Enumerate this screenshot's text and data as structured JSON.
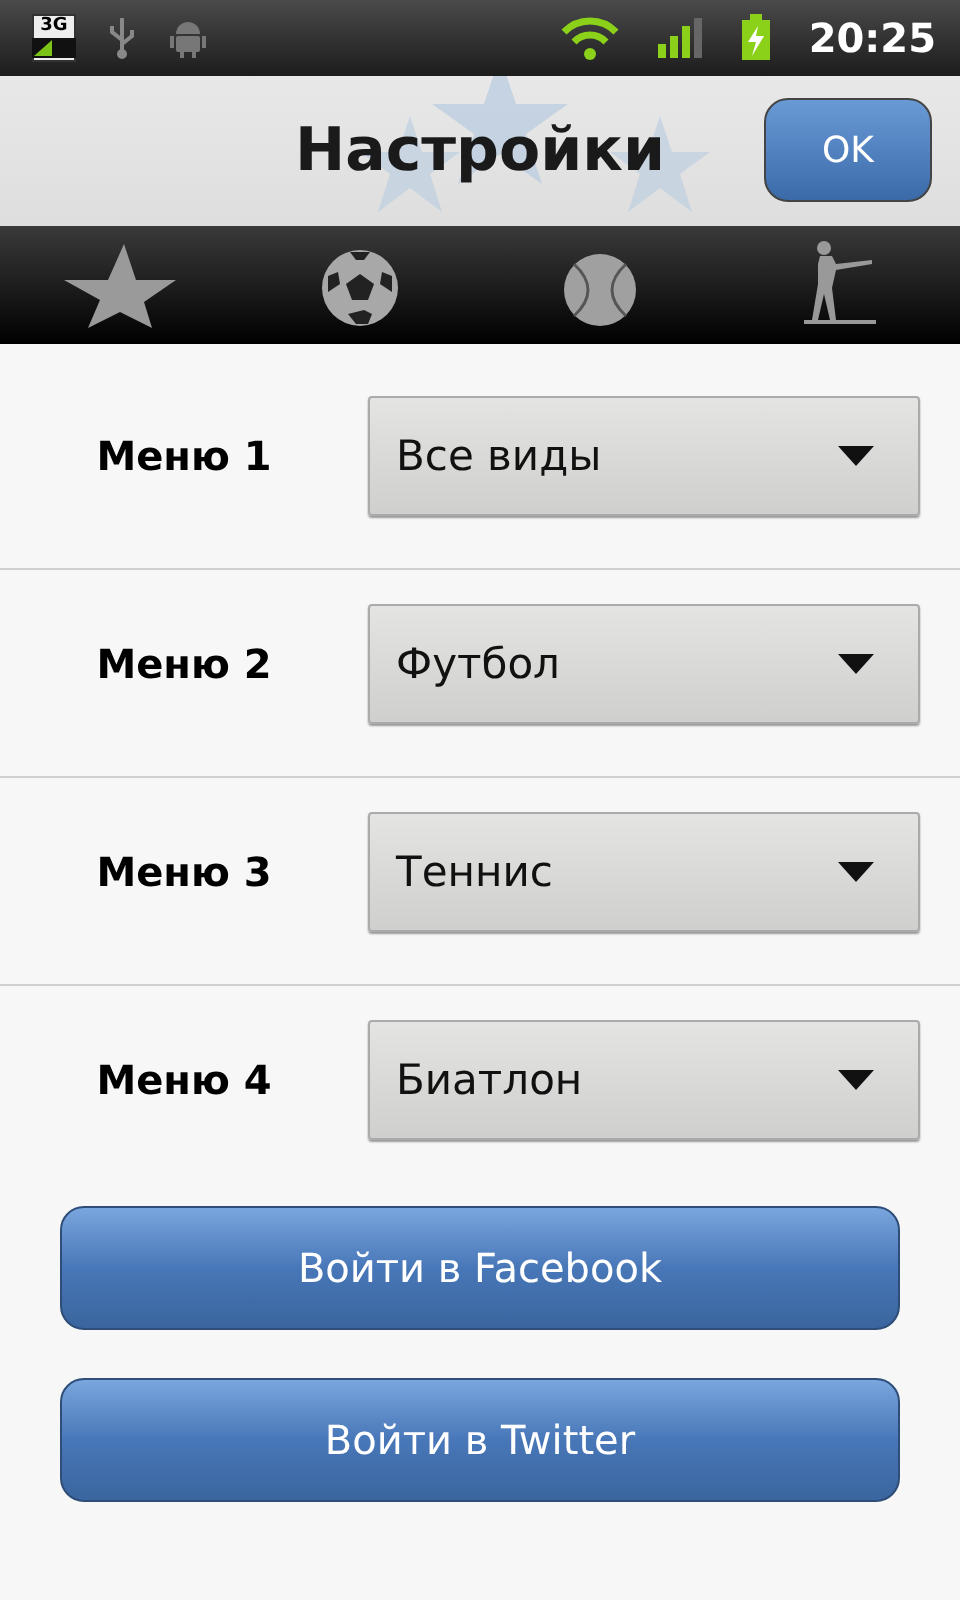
{
  "status_bar": {
    "network": "3G",
    "time": "20:25"
  },
  "header": {
    "title": "Настройки",
    "ok_button": "OK"
  },
  "tabs": [
    {
      "kind": "star"
    },
    {
      "kind": "soccer"
    },
    {
      "kind": "tennis"
    },
    {
      "kind": "biathlon"
    }
  ],
  "menus": [
    {
      "label": "Меню 1",
      "value": "Все виды"
    },
    {
      "label": "Меню 2",
      "value": "Футбол"
    },
    {
      "label": "Меню 3",
      "value": "Теннис"
    },
    {
      "label": "Меню 4",
      "value": "Биатлон"
    }
  ],
  "buttons": [
    "Войти в Facebook",
    "Войти в Twitter"
  ]
}
